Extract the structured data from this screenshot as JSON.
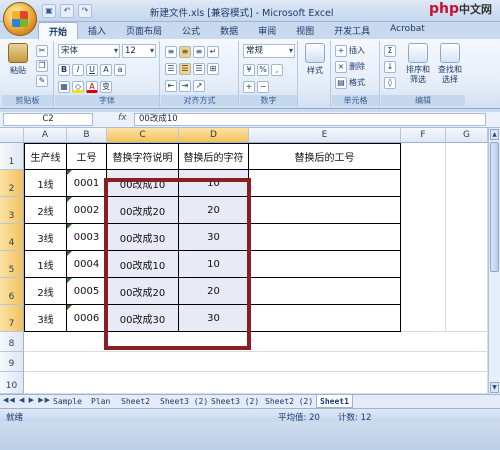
{
  "window": {
    "title": "新建文件.xls [兼容模式] - Microsoft Excel",
    "watermark_brand": "php",
    "watermark_text": "中文网"
  },
  "ribbon_tabs": [
    "开始",
    "插入",
    "页面布局",
    "公式",
    "数据",
    "审阅",
    "视图",
    "开发工具",
    "Acrobat"
  ],
  "ribbon": {
    "paste_label": "粘贴",
    "font_name": "宋体",
    "font_size": "12",
    "number_format": "常规",
    "style_label": "样式",
    "insert_label": "插入",
    "delete_label": "删除",
    "format_label": "格式",
    "sort_filter_label": "排序和筛选",
    "find_select_label": "查找和选择",
    "groups": {
      "clipboard": "剪贴板",
      "font": "字体",
      "alignment": "对齐方式",
      "number": "数字",
      "cells": "单元格",
      "editing": "编辑"
    }
  },
  "formula_bar": {
    "name_box": "C2",
    "fx": "fx",
    "content": "00改成10"
  },
  "columns": [
    "A",
    "B",
    "C",
    "D",
    "E",
    "F",
    "G"
  ],
  "rows": [
    "1",
    "2",
    "3",
    "4",
    "5",
    "6",
    "7",
    "8",
    "9",
    "10"
  ],
  "table": {
    "headers": [
      "生产线",
      "工号",
      "替换字符说明",
      "替换后的字符",
      "替换后的工号"
    ],
    "data": [
      [
        "1线",
        "0001",
        "00改成10",
        "10"
      ],
      [
        "2线",
        "0002",
        "00改成20",
        "20"
      ],
      [
        "3线",
        "0003",
        "00改成30",
        "30"
      ],
      [
        "1线",
        "0004",
        "00改成10",
        "10"
      ],
      [
        "2线",
        "0005",
        "00改成20",
        "20"
      ],
      [
        "3线",
        "0006",
        "00改成30",
        "30"
      ]
    ]
  },
  "sheets": [
    "Sample",
    "Plan",
    "Sheet2",
    "Sheet3 (2)",
    "Sheet3 (2)",
    "Sheet2 (2)",
    "Sheet1"
  ],
  "status": {
    "ready": "就绪",
    "average": "平均值: 20",
    "count": "计数: 12"
  },
  "colors": {
    "highlight_border": "#8b1d23",
    "selected_header": "#f3c15f",
    "selected_cell": "#e8eaf6"
  }
}
